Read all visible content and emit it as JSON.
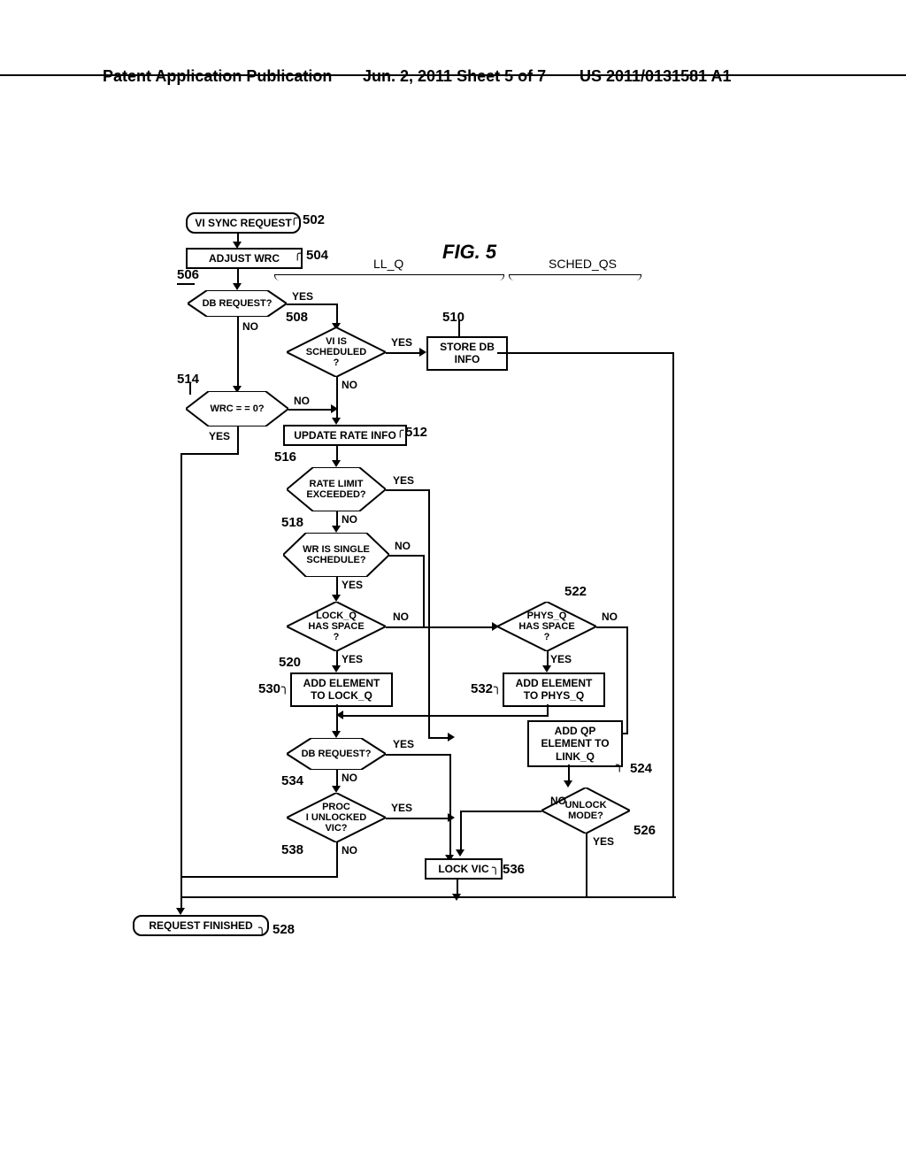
{
  "header": {
    "left": "Patent Application Publication",
    "center": "Jun. 2, 2011  Sheet 5 of 7",
    "right": "US 2011/0131581 A1"
  },
  "figure": {
    "title": "FIG. 5",
    "region_llq": "LL_Q",
    "region_schedqs": "SCHED_QS"
  },
  "nodes": {
    "n502": "VI SYNC REQUEST",
    "n504": "ADJUST WRC",
    "n506": "DB REQUEST?",
    "n508": "VI IS\nSCHEDULED\n?",
    "n510": "STORE DB\nINFO",
    "n512": "UPDATE RATE INFO",
    "n514": "WRC = = 0?",
    "n516": "RATE LIMIT\nEXCEEDED?",
    "n518": "WR IS SINGLE\nSCHEDULE?",
    "n520": "LOCK_Q\nHAS SPACE\n?",
    "n522": "PHYS_Q\nHAS SPACE\n?",
    "n530": "ADD ELEMENT\nTO LOCK_Q",
    "n532": "ADD ELEMENT\nTO PHYS_Q",
    "n524": "ADD QP\nELEMENT TO\nLINK_Q",
    "n526": "UNLOCK\nMODE?",
    "n534": "DB REQUEST?",
    "n536": "LOCK VIC",
    "n538": "PROC\nI UNLOCKED\nVIC?",
    "n528": "REQUEST FINISHED"
  },
  "refs": {
    "r502": "502",
    "r504": "504",
    "r506": "506",
    "r508": "508",
    "r510": "510",
    "r512": "512",
    "r514": "514",
    "r516": "516",
    "r518": "518",
    "r520": "520",
    "r522": "522",
    "r524": "524",
    "r526": "526",
    "r528": "528",
    "r530": "530",
    "r532": "532",
    "r534": "534",
    "r536": "536",
    "r538": "538"
  },
  "labels": {
    "yes": "YES",
    "no": "NO"
  }
}
